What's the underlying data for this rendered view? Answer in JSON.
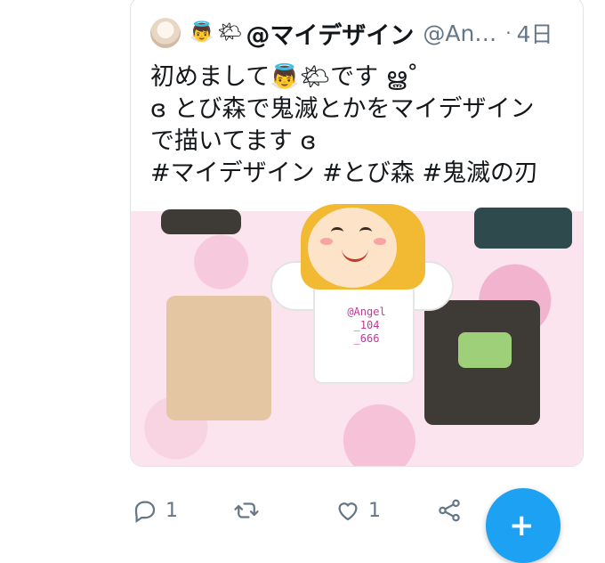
{
  "tweet": {
    "avatar_icon": "avatar-image",
    "name_emojis": [
      "👼",
      "🌤"
    ],
    "name": "@マイデザイン",
    "handle": "@An…",
    "separator": "·",
    "time": "4日",
    "text": "初めまして👼🌤です ൠ˚\nɞ とび森で鬼滅とかをマイデザイン\nで描いてます ɞ\n#マイデザイン #とび森 #鬼滅の刃"
  },
  "media": {
    "shirt_text": "@Angel\n_104\n_666"
  },
  "actions": {
    "reply_count": "1",
    "retweet_count": "",
    "like_count": "1",
    "share_icon": "share-icon"
  },
  "fab": {
    "icon": "compose-tweet-icon",
    "label": "+"
  },
  "colors": {
    "accent": "#1da1f2",
    "muted": "#657786",
    "border": "#dfe3e6"
  }
}
